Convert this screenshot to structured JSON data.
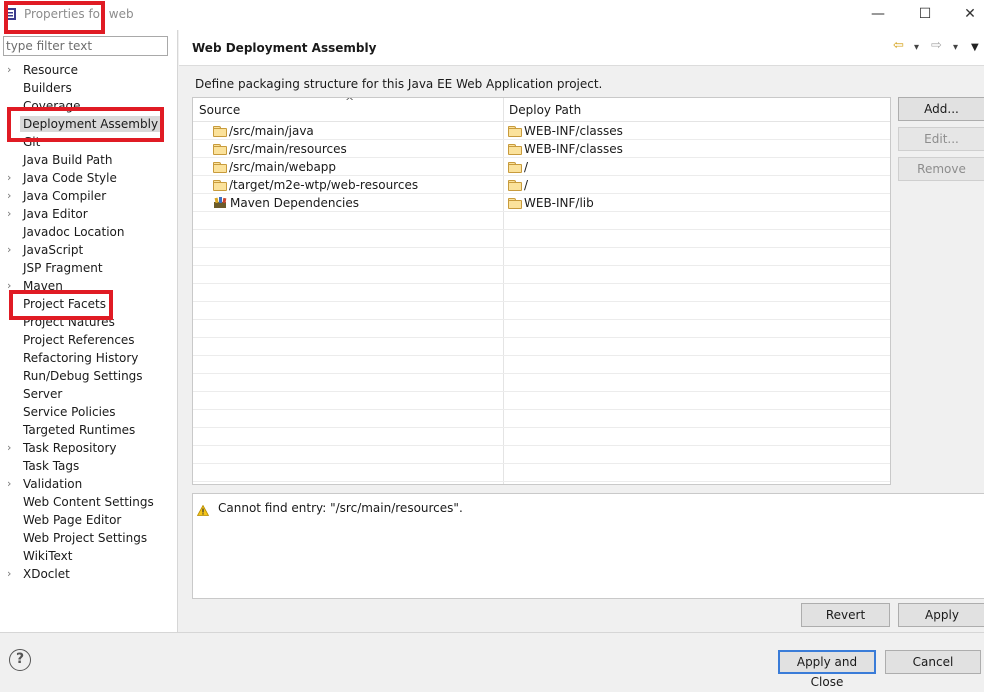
{
  "window": {
    "title": "Properties for web",
    "minimize_glyph": "—",
    "maximize_glyph": "☐",
    "close_glyph": "✕"
  },
  "sidebar": {
    "filter_placeholder": "type filter text",
    "items": [
      {
        "label": "Resource",
        "expandable": true
      },
      {
        "label": "Builders",
        "expandable": false
      },
      {
        "label": "Coverage",
        "expandable": false
      },
      {
        "label": "Deployment Assembly",
        "expandable": false,
        "selected": true
      },
      {
        "label": "Git",
        "expandable": false
      },
      {
        "label": "Java Build Path",
        "expandable": false
      },
      {
        "label": "Java Code Style",
        "expandable": true
      },
      {
        "label": "Java Compiler",
        "expandable": true
      },
      {
        "label": "Java Editor",
        "expandable": true
      },
      {
        "label": "Javadoc Location",
        "expandable": false
      },
      {
        "label": "JavaScript",
        "expandable": true
      },
      {
        "label": "JSP Fragment",
        "expandable": false
      },
      {
        "label": "Maven",
        "expandable": true
      },
      {
        "label": "Project Facets",
        "expandable": false
      },
      {
        "label": "Project Natures",
        "expandable": false
      },
      {
        "label": "Project References",
        "expandable": false
      },
      {
        "label": "Refactoring History",
        "expandable": false
      },
      {
        "label": "Run/Debug Settings",
        "expandable": false
      },
      {
        "label": "Server",
        "expandable": false
      },
      {
        "label": "Service Policies",
        "expandable": false
      },
      {
        "label": "Targeted Runtimes",
        "expandable": false
      },
      {
        "label": "Task Repository",
        "expandable": true
      },
      {
        "label": "Task Tags",
        "expandable": false
      },
      {
        "label": "Validation",
        "expandable": true
      },
      {
        "label": "Web Content Settings",
        "expandable": false
      },
      {
        "label": "Web Page Editor",
        "expandable": false
      },
      {
        "label": "Web Project Settings",
        "expandable": false
      },
      {
        "label": "WikiText",
        "expandable": false
      },
      {
        "label": "XDoclet",
        "expandable": true
      }
    ]
  },
  "header": {
    "title": "Web Deployment Assembly",
    "back_glyph": "⇦",
    "forward_glyph": "⇨",
    "dropdown_glyph": "▾",
    "menu_glyph": "▼"
  },
  "main": {
    "description": "Define packaging structure for this Java EE Web Application project.",
    "table": {
      "columns": [
        "Source",
        "Deploy Path"
      ],
      "sort_indicator": "^",
      "rows": [
        {
          "source": "/src/main/java",
          "source_icon": "folder-icon",
          "deploy": "WEB-INF/classes"
        },
        {
          "source": "/src/main/resources",
          "source_icon": "folder-icon",
          "deploy": "WEB-INF/classes"
        },
        {
          "source": "/src/main/webapp",
          "source_icon": "folder-icon",
          "deploy": "/"
        },
        {
          "source": "/target/m2e-wtp/web-resources",
          "source_icon": "folder-icon",
          "deploy": "/"
        },
        {
          "source": "Maven Dependencies",
          "source_icon": "library-icon",
          "deploy": "WEB-INF/lib"
        }
      ],
      "empty_rows": 15
    },
    "buttons": {
      "add": "Add...",
      "edit": "Edit...",
      "remove": "Remove"
    },
    "message": {
      "icon": "warning-icon",
      "text": "Cannot find entry: \"/src/main/resources\"."
    },
    "revert_label": "Revert",
    "apply_label": "Apply"
  },
  "footer": {
    "help_glyph": "?",
    "apply_close_label": "Apply and Close",
    "cancel_label": "Cancel"
  },
  "colors": {
    "highlight_box": "#e01b24",
    "default_button_border": "#3a7cd8",
    "folder": "#fbe29b"
  }
}
